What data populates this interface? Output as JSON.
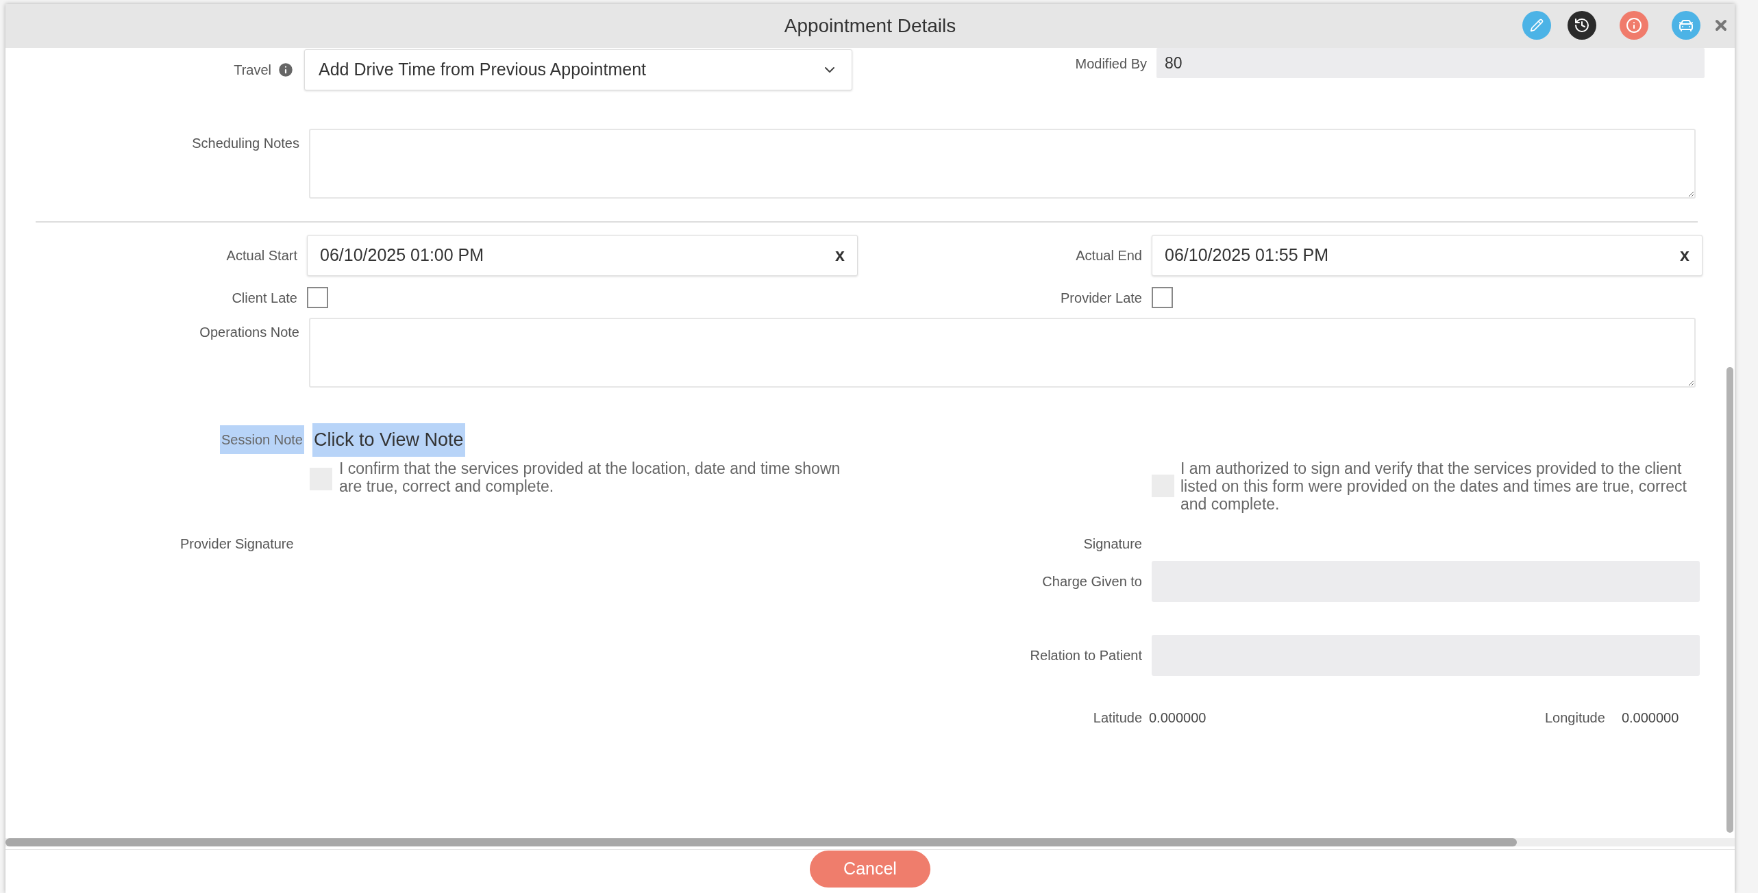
{
  "window": {
    "title": "Appointment Details"
  },
  "travel": {
    "label": "Travel",
    "value": "Add Drive Time from Previous Appointment"
  },
  "modified_by": {
    "label": "Modified By",
    "value": "80"
  },
  "scheduling_notes": {
    "label": "Scheduling Notes"
  },
  "actual_start": {
    "label": "Actual Start",
    "value": "06/10/2025 01:00 PM",
    "clear": "x"
  },
  "actual_end": {
    "label": "Actual End",
    "value": "06/10/2025 01:55 PM",
    "clear": "x"
  },
  "client_late": {
    "label": "Client Late",
    "checked": false
  },
  "provider_late": {
    "label": "Provider Late",
    "checked": false
  },
  "operations_note": {
    "label": "Operations Note"
  },
  "session_note": {
    "label": "Session Note",
    "link": "Click to View Note"
  },
  "attestations": [
    {
      "text": "I confirm that the services provided at the location, date and time shown are true, correct and complete.",
      "checked": false
    },
    {
      "text": "I am authorized to sign and verify that the services provided to the client listed on this form were provided on the dates and times are true, correct and complete.",
      "checked": false
    }
  ],
  "provider_signature": {
    "label": "Provider Signature"
  },
  "signature": {
    "label": "Signature"
  },
  "charge_given_to": {
    "label": "Charge Given to"
  },
  "relation_to_patient": {
    "label": "Relation to Patient"
  },
  "latitude": {
    "label": "Latitude",
    "value": "0.000000"
  },
  "longitude": {
    "label": "Longitude",
    "value": "0.000000"
  },
  "cancel_button": {
    "label": "Cancel"
  }
}
